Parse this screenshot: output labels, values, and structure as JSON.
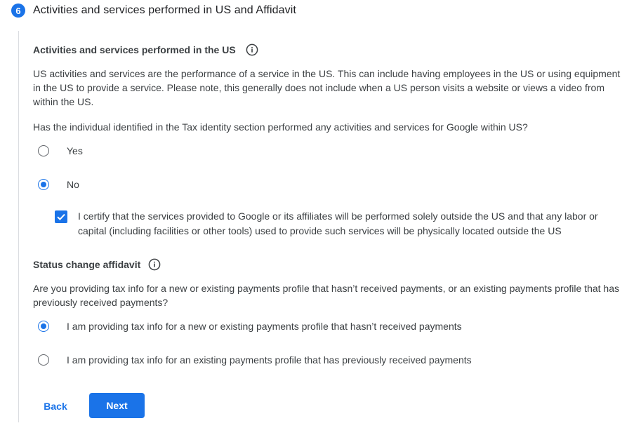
{
  "step": {
    "number": "6",
    "title": "Activities and services performed in US and Affidavit"
  },
  "activities": {
    "heading": "Activities and services performed in the US",
    "description": "US activities and services are the performance of a service in the US. This can include having employees in the US or using equipment in the US to provide a service. Please note, this generally does not include when a US person visits a website or views a video from within the US.",
    "question": "Has the individual identified in the Tax identity section performed any activities and services for Google within US?",
    "options": [
      {
        "label": "Yes",
        "checked": false
      },
      {
        "label": "No",
        "checked": true
      }
    ],
    "certify": {
      "label": "I certify that the services provided to Google or its affiliates will be performed solely outside the US and that any labor or capital (including facilities or other tools) used to provide such services will be physically located outside the US",
      "checked": true
    }
  },
  "affidavit": {
    "heading": "Status change affidavit",
    "question": "Are you providing tax info for a new or existing payments profile that hasn’t received payments, or an existing payments profile that has previously received payments?",
    "options": [
      {
        "label": "I am providing tax info for a new or existing payments profile that hasn’t received payments",
        "checked": true
      },
      {
        "label": "I am providing tax info for an existing payments profile that has previously received payments",
        "checked": false
      }
    ]
  },
  "actions": {
    "back_label": "Back",
    "next_label": "Next"
  },
  "colors": {
    "accent": "#1a73e8",
    "text": "#3c4043",
    "divider": "#dadce0"
  }
}
